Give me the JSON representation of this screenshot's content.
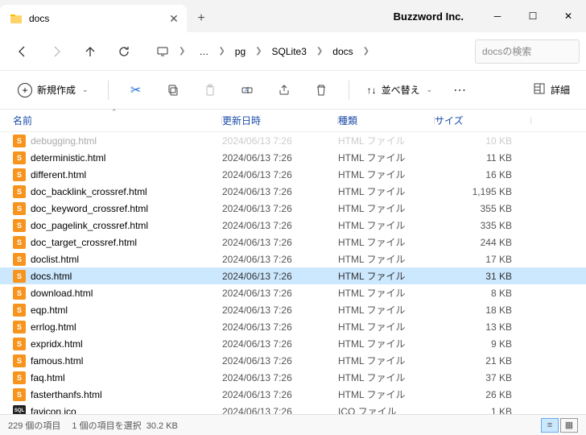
{
  "tab": {
    "title": "docs"
  },
  "brand": "Buzzword Inc.",
  "breadcrumb": [
    "pg",
    "SQLite3",
    "docs"
  ],
  "search": {
    "placeholder": "docsの検索"
  },
  "toolbar": {
    "new_label": "新規作成",
    "sort_label": "並べ替え",
    "details_label": "詳細"
  },
  "columns": {
    "name": "名前",
    "date": "更新日時",
    "type": "種類",
    "size": "サイズ"
  },
  "files": [
    {
      "name": "debugging.html",
      "date": "2024/06/13 7:26",
      "type": "HTML ファイル",
      "size": "10 KB",
      "dimmed": true
    },
    {
      "name": "deterministic.html",
      "date": "2024/06/13 7:26",
      "type": "HTML ファイル",
      "size": "11 KB"
    },
    {
      "name": "different.html",
      "date": "2024/06/13 7:26",
      "type": "HTML ファイル",
      "size": "16 KB"
    },
    {
      "name": "doc_backlink_crossref.html",
      "date": "2024/06/13 7:26",
      "type": "HTML ファイル",
      "size": "1,195 KB"
    },
    {
      "name": "doc_keyword_crossref.html",
      "date": "2024/06/13 7:26",
      "type": "HTML ファイル",
      "size": "355 KB"
    },
    {
      "name": "doc_pagelink_crossref.html",
      "date": "2024/06/13 7:26",
      "type": "HTML ファイル",
      "size": "335 KB"
    },
    {
      "name": "doc_target_crossref.html",
      "date": "2024/06/13 7:26",
      "type": "HTML ファイル",
      "size": "244 KB"
    },
    {
      "name": "doclist.html",
      "date": "2024/06/13 7:26",
      "type": "HTML ファイル",
      "size": "17 KB"
    },
    {
      "name": "docs.html",
      "date": "2024/06/13 7:26",
      "type": "HTML ファイル",
      "size": "31 KB",
      "selected": true
    },
    {
      "name": "download.html",
      "date": "2024/06/13 7:26",
      "type": "HTML ファイル",
      "size": "8 KB"
    },
    {
      "name": "eqp.html",
      "date": "2024/06/13 7:26",
      "type": "HTML ファイル",
      "size": "18 KB"
    },
    {
      "name": "errlog.html",
      "date": "2024/06/13 7:26",
      "type": "HTML ファイル",
      "size": "13 KB"
    },
    {
      "name": "expridx.html",
      "date": "2024/06/13 7:26",
      "type": "HTML ファイル",
      "size": "9 KB"
    },
    {
      "name": "famous.html",
      "date": "2024/06/13 7:26",
      "type": "HTML ファイル",
      "size": "21 KB"
    },
    {
      "name": "faq.html",
      "date": "2024/06/13 7:26",
      "type": "HTML ファイル",
      "size": "37 KB"
    },
    {
      "name": "fasterthanfs.html",
      "date": "2024/06/13 7:26",
      "type": "HTML ファイル",
      "size": "26 KB"
    },
    {
      "name": "favicon.ico",
      "date": "2024/06/13 7:26",
      "type": "ICO ファイル",
      "size": "1 KB",
      "ico": true
    }
  ],
  "status": {
    "count": "229 個の項目",
    "selection": "1 個の項目を選択",
    "size": "30.2 KB"
  }
}
